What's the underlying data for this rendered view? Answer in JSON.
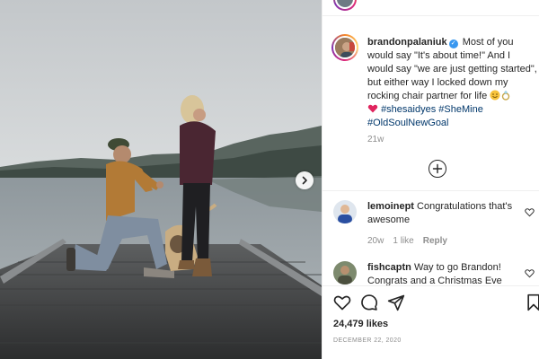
{
  "post": {
    "author": "brandonpalaniuk",
    "caption_text": "Most of you would say \"It's about time!\" And I would say \"we are just getting started\", but either way I locked down my rocking chair partner for life",
    "emojis": [
      "smiling-face-emoji",
      "ring-emoji",
      "red-heart-emoji"
    ],
    "hashtags": [
      "#shesaidyes",
      "#SheMine",
      "#OldSoulNewGoal"
    ],
    "time_ago": "21w",
    "likes_label": "24,479 likes",
    "date": "DECEMBER 22, 2020"
  },
  "comments": [
    {
      "username": "lemoinept",
      "text": "Congratulations that's awesome",
      "time_ago": "20w",
      "likes": "1 like",
      "reply_label": "Reply"
    },
    {
      "username": "fishcaptn",
      "text": "Way to go Brandon! Congrats and a Christmas Eve",
      "time_ago": "",
      "likes": "",
      "reply_label": ""
    }
  ],
  "icons": {
    "verified": "verified-badge-icon",
    "next": "chevron-right-icon",
    "load_more": "plus-circle-icon",
    "like": "heart-icon",
    "comment": "comment-bubble-icon",
    "share": "paper-plane-icon",
    "save": "bookmark-icon"
  },
  "colors": {
    "hashtag": "#00376b",
    "verified": "#3897f0",
    "secondary_text": "#8e8e8e",
    "heart_emoji": "#e0245e"
  }
}
